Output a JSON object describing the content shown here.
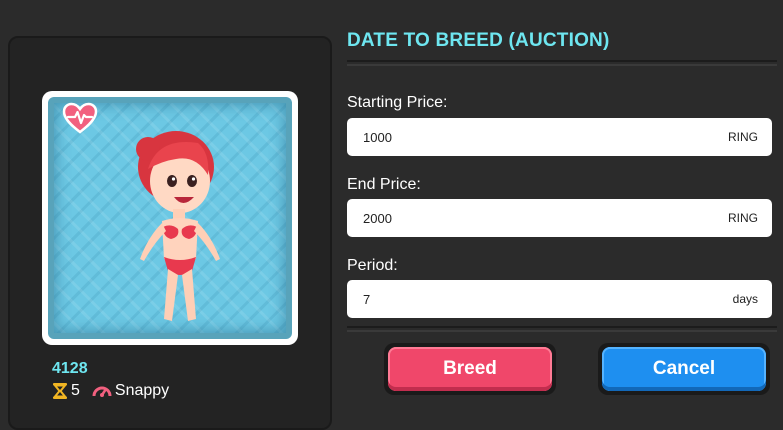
{
  "form": {
    "title": "DATE TO BREED (AUCTION)",
    "starting_price": {
      "label": "Starting Price:",
      "value": "1000",
      "unit": "RING"
    },
    "end_price": {
      "label": "End Price:",
      "value": "2000",
      "unit": "RING"
    },
    "period": {
      "label": "Period:",
      "value": "7",
      "unit": "days"
    }
  },
  "card": {
    "id": "4128",
    "generation": "5",
    "trait": "Snappy",
    "icons": {
      "badge": "heart-rate-icon",
      "generation": "hourglass-icon",
      "trait": "speedometer-icon"
    }
  },
  "buttons": {
    "breed": "Breed",
    "cancel": "Cancel"
  },
  "colors": {
    "accent": "#6ee6f0",
    "breed": "#f0476a",
    "cancel": "#1e8ff0",
    "background": "#2b2b2b"
  }
}
